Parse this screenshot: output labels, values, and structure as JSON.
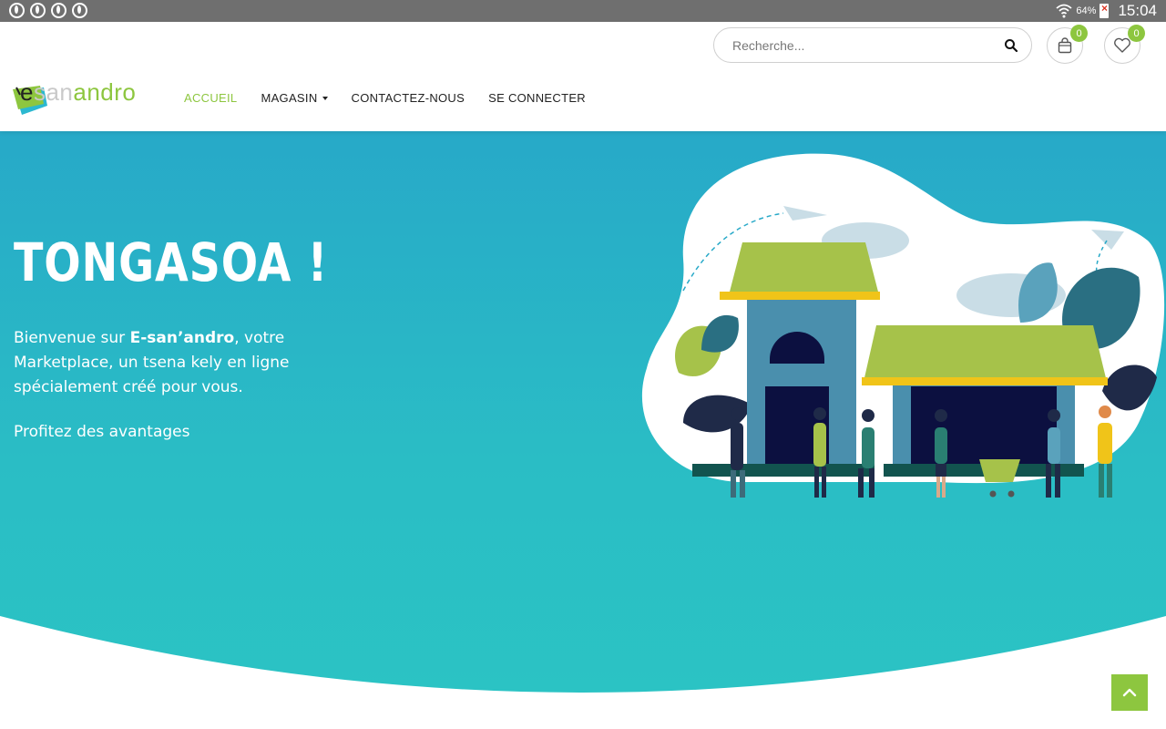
{
  "status_bar": {
    "battery": "64%",
    "time": "15:04"
  },
  "header": {
    "search": {
      "placeholder": "Recherche..."
    },
    "cart": {
      "count": "0"
    },
    "wishlist": {
      "count": "0"
    },
    "logo": {
      "part1": "e",
      "part2": "san",
      "part3": "andro"
    },
    "nav": [
      {
        "label": "ACCUEIL",
        "active": true
      },
      {
        "label": "MAGASIN",
        "dropdown": true
      },
      {
        "label": "CONTACTEZ-NOUS"
      },
      {
        "label": "SE CONNECTER"
      }
    ]
  },
  "hero": {
    "title": "TONGASOA !",
    "intro_before": "Bienvenue sur ",
    "brand": "E-san’andro",
    "intro_after": ", votre Marketplace, un tsena kely en ligne spécialement créé pour vous.",
    "cta": "Profitez des avantages"
  },
  "colors": {
    "accent": "#8dc63f",
    "hero_top": "#27a9c8",
    "hero_bottom": "#2bc4c4"
  },
  "icons": [
    "search-icon",
    "cart-icon",
    "heart-icon",
    "chevron-up-icon"
  ]
}
